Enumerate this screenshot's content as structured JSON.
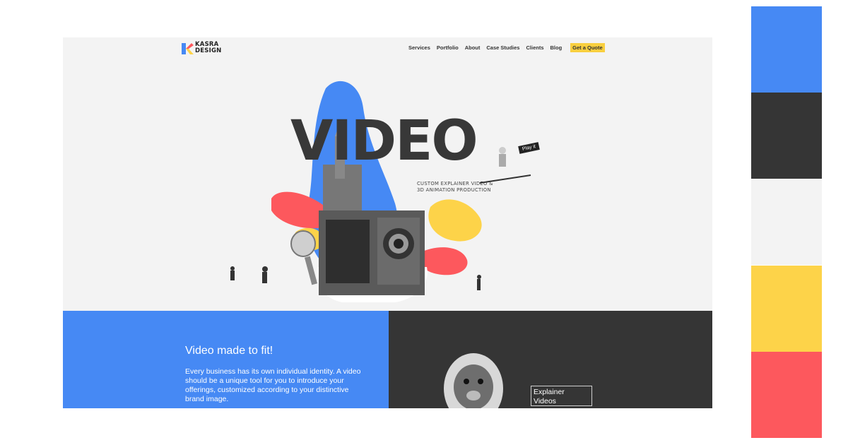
{
  "brand": {
    "logo_text_line1": "KASRA",
    "logo_text_line2": "DESIGN"
  },
  "nav": {
    "items": [
      "Services",
      "Portfolio",
      "About",
      "Case Studies",
      "Clients",
      "Blog"
    ],
    "cta_label": "Get a Quote"
  },
  "hero": {
    "title": "VIDEO",
    "subtitle_line1": "CUSTOM EXPLAINER VIDEO &",
    "subtitle_line2": "3D ANIMATION PRODUCTION",
    "play_sign": "Play it"
  },
  "section": {
    "title": "Video made to fit!",
    "body": "Every business has its own individual identity. A video should be a unique tool for you to introduce your offerings, customized according to your distinctive brand image.",
    "card_label_line1": "Explainer",
    "card_label_line2": "Videos"
  },
  "palette": {
    "colors": [
      "#4689f4",
      "#353535",
      "#f3f3f3",
      "#fdd349",
      "#fd585d"
    ]
  }
}
